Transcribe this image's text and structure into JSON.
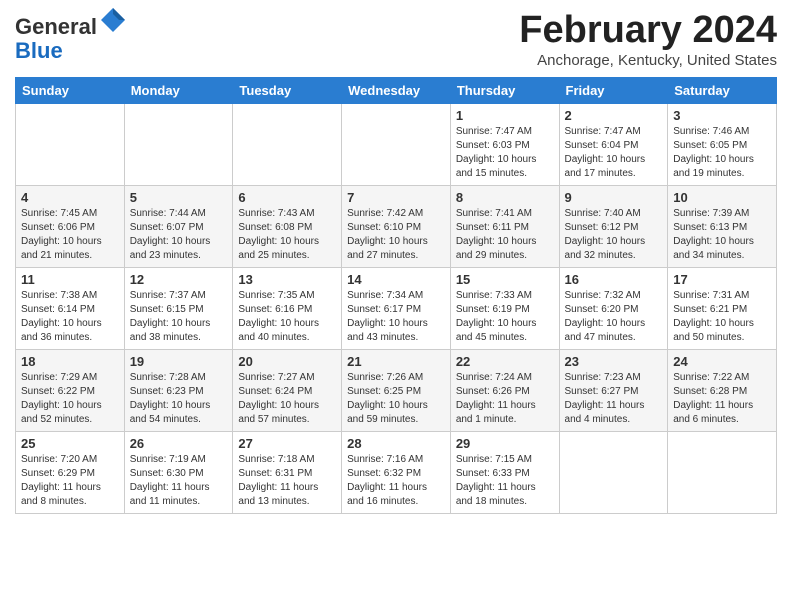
{
  "header": {
    "logo_line1": "General",
    "logo_line2": "Blue",
    "month_title": "February 2024",
    "location": "Anchorage, Kentucky, United States"
  },
  "days_of_week": [
    "Sunday",
    "Monday",
    "Tuesday",
    "Wednesday",
    "Thursday",
    "Friday",
    "Saturday"
  ],
  "weeks": [
    [
      {
        "day": "",
        "info": ""
      },
      {
        "day": "",
        "info": ""
      },
      {
        "day": "",
        "info": ""
      },
      {
        "day": "",
        "info": ""
      },
      {
        "day": "1",
        "info": "Sunrise: 7:47 AM\nSunset: 6:03 PM\nDaylight: 10 hours and 15 minutes."
      },
      {
        "day": "2",
        "info": "Sunrise: 7:47 AM\nSunset: 6:04 PM\nDaylight: 10 hours and 17 minutes."
      },
      {
        "day": "3",
        "info": "Sunrise: 7:46 AM\nSunset: 6:05 PM\nDaylight: 10 hours and 19 minutes."
      }
    ],
    [
      {
        "day": "4",
        "info": "Sunrise: 7:45 AM\nSunset: 6:06 PM\nDaylight: 10 hours and 21 minutes."
      },
      {
        "day": "5",
        "info": "Sunrise: 7:44 AM\nSunset: 6:07 PM\nDaylight: 10 hours and 23 minutes."
      },
      {
        "day": "6",
        "info": "Sunrise: 7:43 AM\nSunset: 6:08 PM\nDaylight: 10 hours and 25 minutes."
      },
      {
        "day": "7",
        "info": "Sunrise: 7:42 AM\nSunset: 6:10 PM\nDaylight: 10 hours and 27 minutes."
      },
      {
        "day": "8",
        "info": "Sunrise: 7:41 AM\nSunset: 6:11 PM\nDaylight: 10 hours and 29 minutes."
      },
      {
        "day": "9",
        "info": "Sunrise: 7:40 AM\nSunset: 6:12 PM\nDaylight: 10 hours and 32 minutes."
      },
      {
        "day": "10",
        "info": "Sunrise: 7:39 AM\nSunset: 6:13 PM\nDaylight: 10 hours and 34 minutes."
      }
    ],
    [
      {
        "day": "11",
        "info": "Sunrise: 7:38 AM\nSunset: 6:14 PM\nDaylight: 10 hours and 36 minutes."
      },
      {
        "day": "12",
        "info": "Sunrise: 7:37 AM\nSunset: 6:15 PM\nDaylight: 10 hours and 38 minutes."
      },
      {
        "day": "13",
        "info": "Sunrise: 7:35 AM\nSunset: 6:16 PM\nDaylight: 10 hours and 40 minutes."
      },
      {
        "day": "14",
        "info": "Sunrise: 7:34 AM\nSunset: 6:17 PM\nDaylight: 10 hours and 43 minutes."
      },
      {
        "day": "15",
        "info": "Sunrise: 7:33 AM\nSunset: 6:19 PM\nDaylight: 10 hours and 45 minutes."
      },
      {
        "day": "16",
        "info": "Sunrise: 7:32 AM\nSunset: 6:20 PM\nDaylight: 10 hours and 47 minutes."
      },
      {
        "day": "17",
        "info": "Sunrise: 7:31 AM\nSunset: 6:21 PM\nDaylight: 10 hours and 50 minutes."
      }
    ],
    [
      {
        "day": "18",
        "info": "Sunrise: 7:29 AM\nSunset: 6:22 PM\nDaylight: 10 hours and 52 minutes."
      },
      {
        "day": "19",
        "info": "Sunrise: 7:28 AM\nSunset: 6:23 PM\nDaylight: 10 hours and 54 minutes."
      },
      {
        "day": "20",
        "info": "Sunrise: 7:27 AM\nSunset: 6:24 PM\nDaylight: 10 hours and 57 minutes."
      },
      {
        "day": "21",
        "info": "Sunrise: 7:26 AM\nSunset: 6:25 PM\nDaylight: 10 hours and 59 minutes."
      },
      {
        "day": "22",
        "info": "Sunrise: 7:24 AM\nSunset: 6:26 PM\nDaylight: 11 hours and 1 minute."
      },
      {
        "day": "23",
        "info": "Sunrise: 7:23 AM\nSunset: 6:27 PM\nDaylight: 11 hours and 4 minutes."
      },
      {
        "day": "24",
        "info": "Sunrise: 7:22 AM\nSunset: 6:28 PM\nDaylight: 11 hours and 6 minutes."
      }
    ],
    [
      {
        "day": "25",
        "info": "Sunrise: 7:20 AM\nSunset: 6:29 PM\nDaylight: 11 hours and 8 minutes."
      },
      {
        "day": "26",
        "info": "Sunrise: 7:19 AM\nSunset: 6:30 PM\nDaylight: 11 hours and 11 minutes."
      },
      {
        "day": "27",
        "info": "Sunrise: 7:18 AM\nSunset: 6:31 PM\nDaylight: 11 hours and 13 minutes."
      },
      {
        "day": "28",
        "info": "Sunrise: 7:16 AM\nSunset: 6:32 PM\nDaylight: 11 hours and 16 minutes."
      },
      {
        "day": "29",
        "info": "Sunrise: 7:15 AM\nSunset: 6:33 PM\nDaylight: 11 hours and 18 minutes."
      },
      {
        "day": "",
        "info": ""
      },
      {
        "day": "",
        "info": ""
      }
    ]
  ]
}
